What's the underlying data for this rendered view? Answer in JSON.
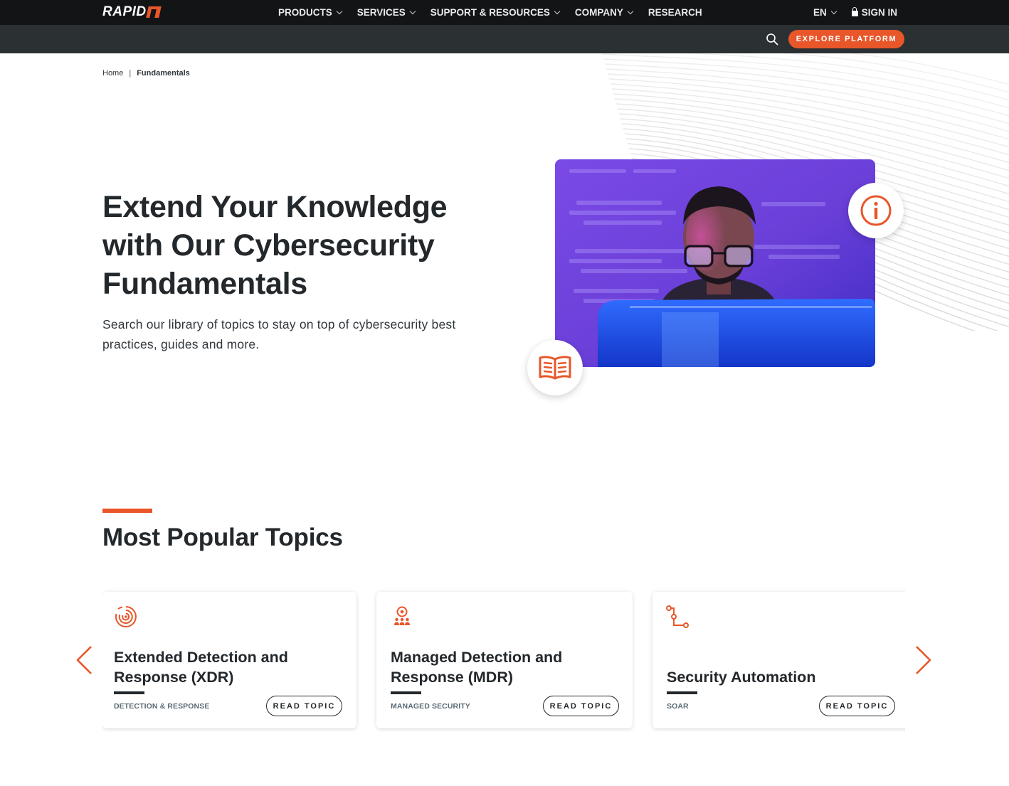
{
  "brand": {
    "logo_text": "RAPID",
    "accent": "#e8562a",
    "nav_bg": "#121416",
    "subnav_bg": "#2b3033"
  },
  "nav": {
    "items": [
      {
        "label": "PRODUCTS",
        "has_dropdown": true
      },
      {
        "label": "SERVICES",
        "has_dropdown": true
      },
      {
        "label": "SUPPORT & RESOURCES",
        "has_dropdown": true
      },
      {
        "label": "COMPANY",
        "has_dropdown": true
      },
      {
        "label": "RESEARCH",
        "has_dropdown": false
      }
    ],
    "language": "EN",
    "sign_in": "SIGN IN"
  },
  "subnav": {
    "search_icon": "search-icon",
    "explore_label": "EXPLORE PLATFORM"
  },
  "breadcrumb": {
    "home": "Home",
    "separator": "|",
    "current": "Fundamentals"
  },
  "hero": {
    "title": "Extend Your Knowledge with Our Cybersecurity Fundamentals",
    "subtitle": "Search our library of topics to stay on top of cybersecurity best practices, guides and more.",
    "badges": [
      "info-icon",
      "open-book-icon"
    ]
  },
  "popular": {
    "title": "Most Popular Topics",
    "cards": [
      {
        "icon": "radar-target-icon",
        "title": "Extended Detection and Response (XDR)",
        "category": "DETECTION & RESPONSE",
        "button": "READ TOPIC"
      },
      {
        "icon": "managed-team-icon",
        "title": "Managed Detection and Response (MDR)",
        "category": "MANAGED SECURITY",
        "button": "READ TOPIC"
      },
      {
        "icon": "workflow-icon",
        "title": "Security Automation",
        "category": "SOAR",
        "button": "READ TOPIC"
      }
    ],
    "prev_icon": "chevron-left-icon",
    "next_icon": "chevron-right-icon"
  }
}
